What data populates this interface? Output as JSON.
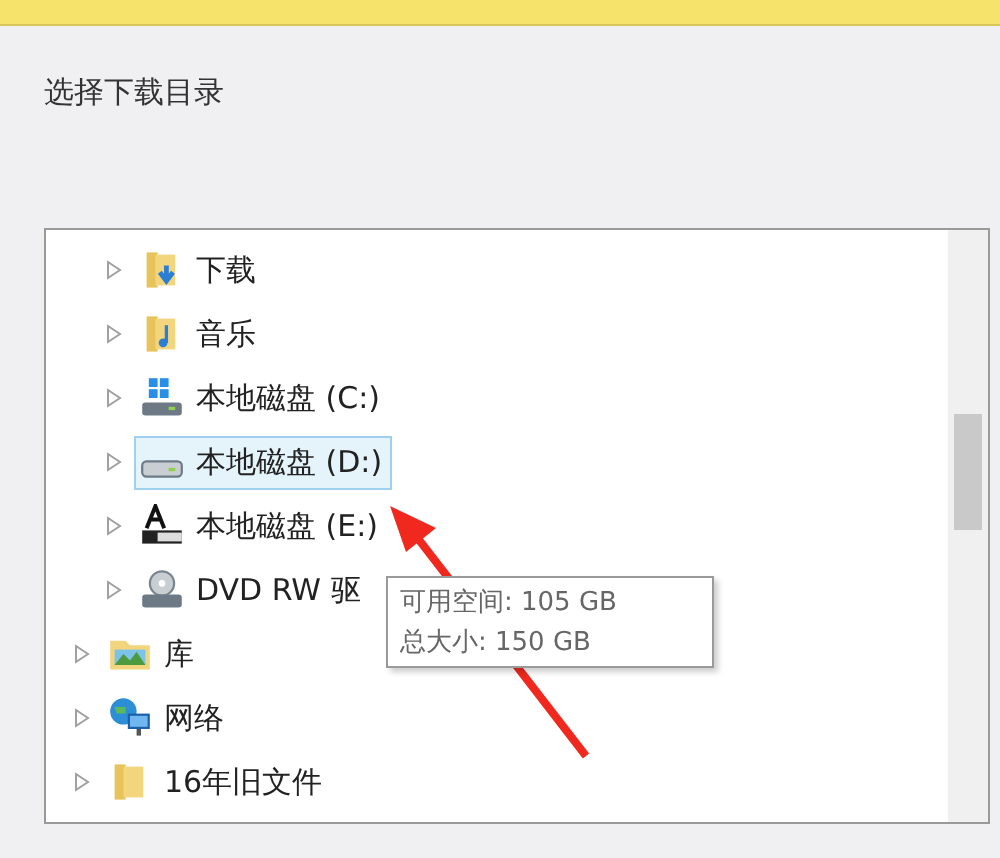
{
  "prompt": "选择下载目录",
  "tree": [
    {
      "children": [
        {
          "label": "下载",
          "selected": false
        },
        {
          "label": "音乐",
          "selected": false
        },
        {
          "label": "本地磁盘 (C:)",
          "selected": false
        },
        {
          "label": "本地磁盘 (D:)",
          "selected": true
        },
        {
          "label": "本地磁盘 (E:)",
          "selected": false
        },
        {
          "label": "DVD RW 驱",
          "selected": false
        }
      ]
    },
    {
      "label": "库",
      "selected": false
    },
    {
      "label": "网络",
      "selected": false
    },
    {
      "label": "16年旧文件",
      "selected": false
    }
  ],
  "tooltip": {
    "lines": [
      "可用空间: 105 GB",
      "总大小: 150 GB"
    ]
  }
}
